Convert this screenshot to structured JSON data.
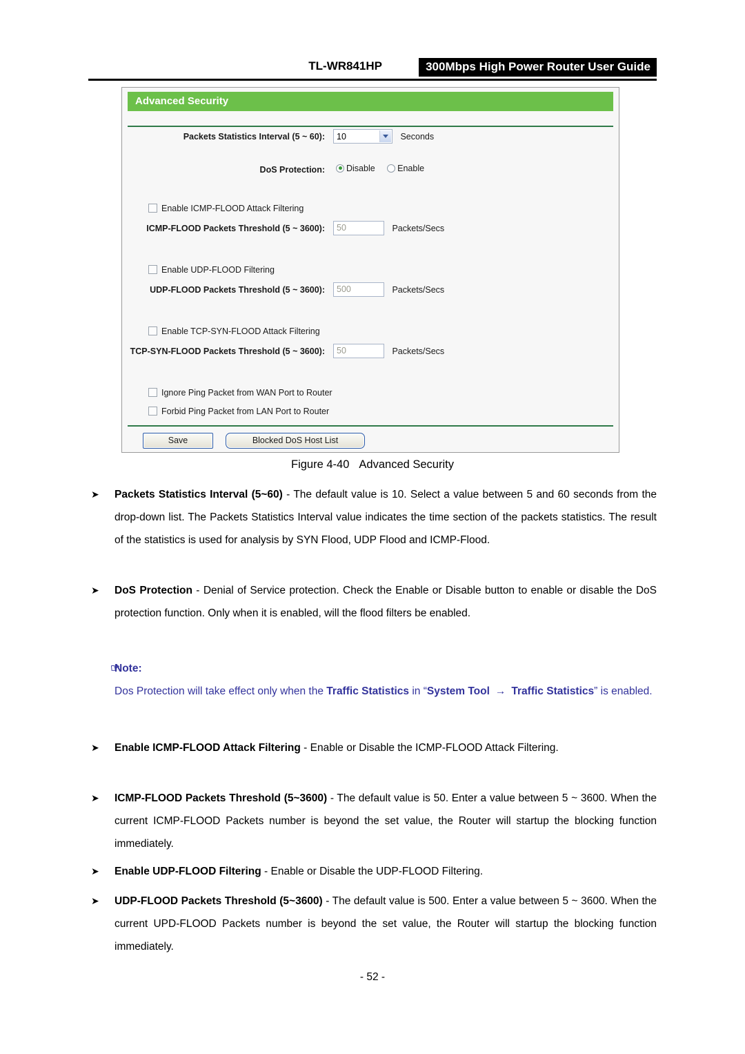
{
  "header": {
    "model": "TL-WR841HP",
    "title": "300Mbps High Power Router User Guide"
  },
  "router_ui": {
    "panel_title": "Advanced Security",
    "packets_interval": {
      "label": "Packets Statistics Interval (5 ~ 60):",
      "value": "10",
      "unit": "Seconds"
    },
    "dos_protection": {
      "label": "DoS Protection:",
      "option_disable": "Disable",
      "option_enable": "Enable",
      "selected": "Disable"
    },
    "icmp": {
      "checkbox_label": "Enable ICMP-FLOOD Attack Filtering",
      "checked": false,
      "threshold_label": "ICMP-FLOOD Packets Threshold (5 ~ 3600):",
      "threshold_value": "50",
      "unit": "Packets/Secs"
    },
    "udp": {
      "checkbox_label": "Enable UDP-FLOOD Filtering",
      "checked": false,
      "threshold_label": "UDP-FLOOD Packets Threshold (5 ~ 3600):",
      "threshold_value": "500",
      "unit": "Packets/Secs"
    },
    "tcp_syn": {
      "checkbox_label": "Enable TCP-SYN-FLOOD Attack Filtering",
      "checked": false,
      "threshold_label": "TCP-SYN-FLOOD Packets Threshold (5 ~ 3600):",
      "threshold_value": "50",
      "unit": "Packets/Secs"
    },
    "ping": {
      "ignore_wan_label": "Ignore Ping Packet from WAN Port to Router",
      "forbid_lan_label": "Forbid Ping Packet from LAN Port to Router"
    },
    "buttons": {
      "save": "Save",
      "blocked_list": "Blocked DoS Host List"
    },
    "colors": {
      "header_green": "#6cc04a",
      "rule_green": "#2f7a49",
      "radio_dot": "#3a9a3a",
      "button_border": "#2a5aa8"
    }
  },
  "figure": {
    "number": "Figure 4-40",
    "caption": "Advanced Security"
  },
  "bullets": {
    "packets_interval": {
      "term": "Packets Statistics Interval (5~60)",
      "dash": " - ",
      "text": "The default value is 10. Select a value between 5 and 60 seconds from the drop-down list. The Packets Statistics Interval value indicates the time section of the packets statistics. The result of the statistics is used for analysis by SYN Flood, UDP Flood and ICMP-Flood."
    },
    "dos_protection": {
      "term": "DoS Protection",
      "dash": " - ",
      "text": "Denial of Service protection. Check the Enable or Disable button to enable or disable the DoS protection function. Only when it is enabled, will the flood filters be enabled."
    },
    "enable_icmp": {
      "term": "Enable ICMP-FLOOD Attack Filtering",
      "dash": " - ",
      "text": "Enable or Disable the ICMP-FLOOD Attack Filtering."
    },
    "icmp_threshold": {
      "term": "ICMP-FLOOD Packets Threshold (5~3600)",
      "dash": " - ",
      "text": "The default value is 50. Enter a value between 5 ~ 3600. When the current ICMP-FLOOD Packets number is beyond the set value, the Router will startup the blocking function immediately."
    },
    "enable_udp": {
      "term": "Enable UDP-FLOOD Filtering",
      "dash": " - ",
      "text": "Enable or Disable the UDP-FLOOD Filtering."
    },
    "udp_threshold": {
      "term": "UDP-FLOOD Packets Threshold (5~3600)",
      "dash": " - ",
      "text": "The default value is 500. Enter a value between 5 ~ 3600. When the current UPD-FLOOD Packets number is beyond the set value, the Router will startup the blocking function immediately."
    }
  },
  "note": {
    "heading": "Note:",
    "hand_icon": "☞",
    "part1": "Dos Protection will take effect only when the ",
    "bold1": "Traffic Statistics",
    "part2": " in “",
    "bold2": "System Tool",
    "arrow": "→",
    "bold3": "Traffic Statistics",
    "part3": "” is enabled.",
    "color": "#33339c"
  },
  "footer": {
    "page_number": "- 52 -"
  }
}
